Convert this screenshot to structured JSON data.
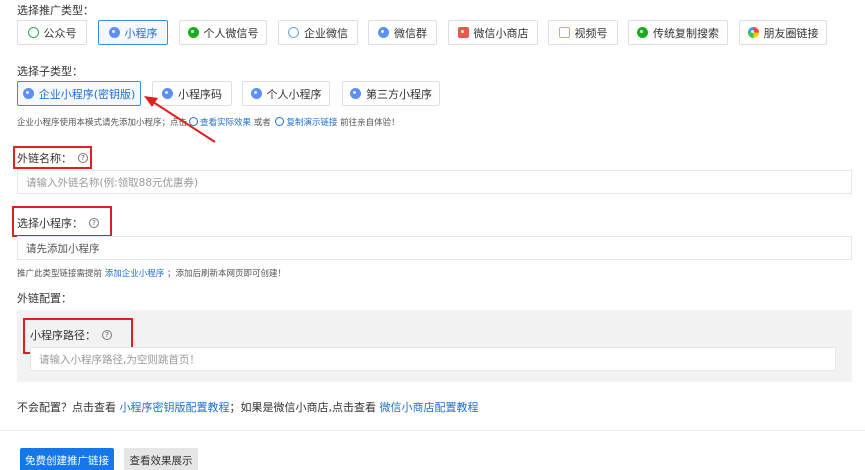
{
  "promo_type": {
    "label": "选择推广类型：",
    "options": [
      {
        "label": "公众号"
      },
      {
        "label": "小程序"
      },
      {
        "label": "个人微信号"
      },
      {
        "label": "企业微信"
      },
      {
        "label": "微信群"
      },
      {
        "label": "微信小商店"
      },
      {
        "label": "视频号"
      },
      {
        "label": "传统复制搜索"
      },
      {
        "label": "朋友圈链接"
      }
    ],
    "selected": "小程序"
  },
  "sub_type": {
    "label": "选择子类型：",
    "options": [
      {
        "label": "企业小程序(密钥版)"
      },
      {
        "label": "小程序码"
      },
      {
        "label": "个人小程序"
      },
      {
        "label": "第三方小程序"
      }
    ],
    "selected": "企业小程序(密钥版)"
  },
  "sub_type_hint": {
    "prefix": "企业小程序使用本模式请先添加小程序；点击",
    "view_effect": "查看实际效果",
    "or": "或者",
    "copy_demo": "复制演示链接",
    "suffix": "前往亲自体验！"
  },
  "link_name": {
    "label": "外链名称：",
    "help": "?",
    "placeholder": "请输入外链名称(例:领取88元优惠券)"
  },
  "mini_program": {
    "label": "选择小程序：",
    "help": "?",
    "value": "请先添加小程序",
    "hint_prefix": "推广此类型链接需提前",
    "hint_link": "添加企业小程序",
    "hint_suffix": "；添加后刷新本网页即可创建！"
  },
  "link_config": {
    "label": "外链配置：",
    "path_label": "小程序路径：",
    "help": "?",
    "path_placeholder": "请输入小程序路径,为空则跳首页！"
  },
  "help_text": {
    "prefix": "不会配置？点击查看",
    "link1": "小程序密钥版配置教程",
    "middle": "；如果是微信小商店,点击查看",
    "link2": "微信小商店配置教程"
  },
  "actions": {
    "create": "免费创建推广链接",
    "preview": "查看效果展示"
  },
  "colors": {
    "accent": "#1677e8",
    "annotation_red": "#e02020"
  }
}
